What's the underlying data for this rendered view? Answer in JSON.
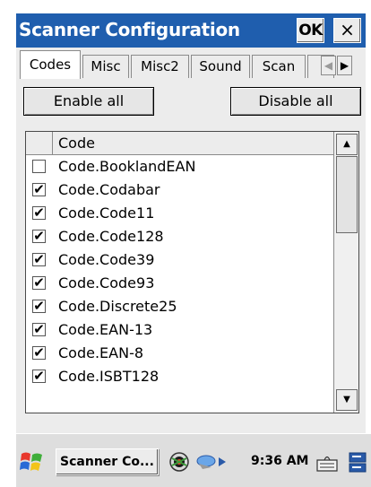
{
  "window": {
    "title": "Scanner Configuration",
    "ok_label": "OK",
    "close_label": "×",
    "title_bar_color": "#1f5eae"
  },
  "tabs": [
    {
      "label": "Codes",
      "active": true
    },
    {
      "label": "Misc",
      "active": false
    },
    {
      "label": "Misc2",
      "active": false
    },
    {
      "label": "Sound",
      "active": false
    },
    {
      "label": "Scan",
      "active": false
    }
  ],
  "tab_scroll": {
    "left_icon": "◀",
    "right_icon": "▶"
  },
  "buttons": {
    "enable_all": "Enable all",
    "disable_all": "Disable all"
  },
  "code_list": {
    "column_header": "Code",
    "rows": [
      {
        "label": "Code.BooklandEAN",
        "checked": false
      },
      {
        "label": "Code.Codabar",
        "checked": true
      },
      {
        "label": "Code.Code11",
        "checked": true
      },
      {
        "label": "Code.Code128",
        "checked": true
      },
      {
        "label": "Code.Code39",
        "checked": true
      },
      {
        "label": "Code.Code93",
        "checked": true
      },
      {
        "label": "Code.Discrete25",
        "checked": true
      },
      {
        "label": "Code.EAN-13",
        "checked": true
      },
      {
        "label": "Code.EAN-8",
        "checked": true
      },
      {
        "label": "Code.ISBT128",
        "checked": true
      }
    ],
    "check_mark": "✔",
    "scroll_up_icon": "▲",
    "scroll_down_icon": "▼"
  },
  "taskbar": {
    "start_icon": "windows-flag-icon",
    "task_button_label": "Scanner Co...",
    "clock": "9:36 AM",
    "tray_icons": [
      "network-icon",
      "connectivity-icon",
      "keyboard-icon",
      "desktop-icon"
    ]
  }
}
